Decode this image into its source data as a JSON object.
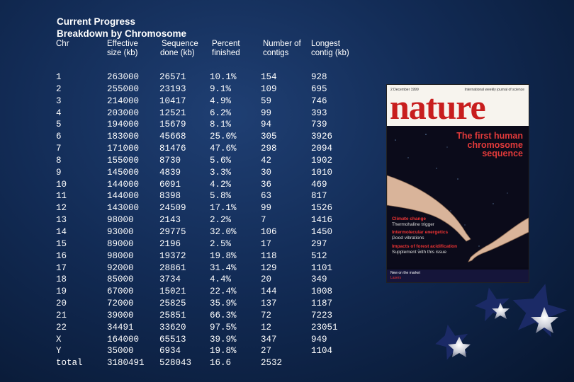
{
  "title": {
    "line1": "Current Progress",
    "line2": "Breakdown by Chromosome"
  },
  "headers": {
    "chr": "Chr",
    "effective_1": "Effective",
    "effective_2": "size (kb)",
    "sequence_1": "Sequence",
    "sequence_2": "done (kb)",
    "percent_1": "Percent",
    "percent_2": "finished",
    "contigs_1": "Number of",
    "contigs_2": "contigs",
    "longest_1": "Longest",
    "longest_2": "contig (kb)"
  },
  "rows": [
    {
      "chr": "1",
      "eff": "263000",
      "seq": "26571",
      "pct": "10.1%",
      "num": "154",
      "longest": "928"
    },
    {
      "chr": "2",
      "eff": "255000",
      "seq": "23193",
      "pct": "9.1%",
      "num": "109",
      "longest": "695"
    },
    {
      "chr": "3",
      "eff": "214000",
      "seq": "10417",
      "pct": "4.9%",
      "num": "59",
      "longest": "746"
    },
    {
      "chr": "4",
      "eff": "203000",
      "seq": "12521",
      "pct": "6.2%",
      "num": "99",
      "longest": "393"
    },
    {
      "chr": "5",
      "eff": "194000",
      "seq": "15679",
      "pct": "8.1%",
      "num": "94",
      "longest": "739"
    },
    {
      "chr": "6",
      "eff": "183000",
      "seq": "45668",
      "pct": "25.0%",
      "num": "305",
      "longest": "3926"
    },
    {
      "chr": "7",
      "eff": "171000",
      "seq": "81476",
      "pct": "47.6%",
      "num": "298",
      "longest": "2094"
    },
    {
      "chr": "8",
      "eff": "155000",
      "seq": "8730",
      "pct": "5.6%",
      "num": "42",
      "longest": "1902"
    },
    {
      "chr": "9",
      "eff": "145000",
      "seq": "4839",
      "pct": "3.3%",
      "num": "30",
      "longest": "1010"
    },
    {
      "chr": "10",
      "eff": "144000",
      "seq": "6091",
      "pct": "4.2%",
      "num": "36",
      "longest": "469"
    },
    {
      "chr": "11",
      "eff": "144000",
      "seq": "8398",
      "pct": "5.8%",
      "num": "63",
      "longest": "817"
    },
    {
      "chr": "12",
      "eff": "143000",
      "seq": "24509",
      "pct": "17.1%",
      "num": "99",
      "longest": "1526"
    },
    {
      "chr": "13",
      "eff": "98000",
      "seq": "2143",
      "pct": "2.2%",
      "num": "7",
      "longest": "1416"
    },
    {
      "chr": "14",
      "eff": "93000",
      "seq": "29775",
      "pct": "32.0%",
      "num": "106",
      "longest": "1450"
    },
    {
      "chr": "15",
      "eff": "89000",
      "seq": "2196",
      "pct": "2.5%",
      "num": "17",
      "longest": "297"
    },
    {
      "chr": "16",
      "eff": "98000",
      "seq": "19372",
      "pct": "19.8%",
      "num": "118",
      "longest": "512"
    },
    {
      "chr": "17",
      "eff": "92000",
      "seq": "28861",
      "pct": "31.4%",
      "num": "129",
      "longest": "1101"
    },
    {
      "chr": "18",
      "eff": "85000",
      "seq": "3734",
      "pct": "4.4%",
      "num": "20",
      "longest": "349"
    },
    {
      "chr": "19",
      "eff": "67000",
      "seq": "15021",
      "pct": "22.4%",
      "num": "144",
      "longest": "1008"
    },
    {
      "chr": "20",
      "eff": "72000",
      "seq": "25825",
      "pct": "35.9%",
      "num": "137",
      "longest": "1187"
    },
    {
      "chr": "21",
      "eff": "39000",
      "seq": "25851",
      "pct": "66.3%",
      "num": "72",
      "longest": "7223"
    },
    {
      "chr": "22",
      "eff": "34491",
      "seq": "33620",
      "pct": "97.5%",
      "num": "12",
      "longest": "23051"
    },
    {
      "chr": "X",
      "eff": "164000",
      "seq": "65513",
      "pct": "39.9%",
      "num": "347",
      "longest": "949"
    },
    {
      "chr": "Y",
      "eff": "35000",
      "seq": "6934",
      "pct": "19.8%",
      "num": "27",
      "longest": "1104"
    },
    {
      "chr": "total",
      "eff": "3180491",
      "seq": "528043",
      "pct": "16.6",
      "num": "2532",
      "longest": ""
    }
  ],
  "cover": {
    "date": "2 December 1999",
    "tagline": "International weekly journal of science",
    "logo": "nature",
    "headline_1": "The first human",
    "headline_2": "chromosome",
    "headline_3": "sequence",
    "blurb1_title": "Climate change",
    "blurb1_sub": "Thermohaline trigger",
    "blurb2_title": "Intermolecular energetics",
    "blurb2_sub": "Good vibrations",
    "blurb3_title": "Impacts of forest acidification",
    "blurb3_sub": "Supplement with this issue",
    "bottom_1": "New on the market",
    "bottom_2": "Lasers"
  },
  "colors": {
    "background": "#122b55",
    "cover_logo": "#c81e1e",
    "cover_headline": "#e23a3a"
  }
}
